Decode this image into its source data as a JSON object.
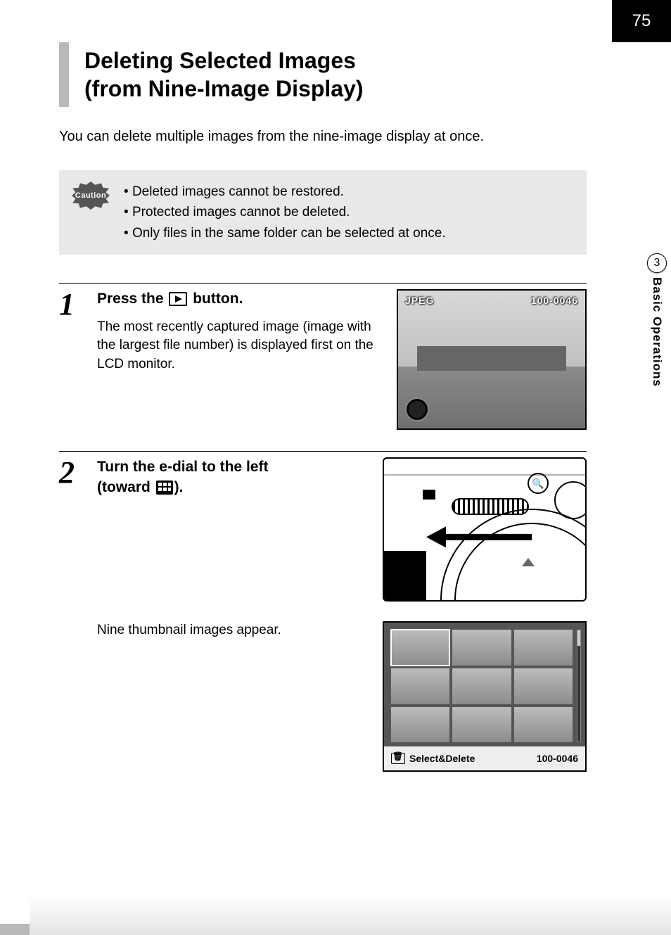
{
  "page_number": "75",
  "side_tab": {
    "chapter_number": "3",
    "chapter_label": "Basic Operations"
  },
  "title": {
    "line1": "Deleting Selected Images",
    "line2": "(from Nine-Image Display)"
  },
  "intro": "You can delete multiple images from the nine-image display at once.",
  "caution": {
    "label": "Caution",
    "items": [
      "Deleted images cannot be restored.",
      "Protected images cannot be deleted.",
      "Only files in the same folder can be selected at once."
    ]
  },
  "step1": {
    "number": "1",
    "heading_prefix": "Press the ",
    "heading_suffix": " button.",
    "desc": "The most recently captured image (image with the largest file number) is displayed first on the LCD monitor.",
    "lcd": {
      "format": "JPEG",
      "file_number": "100-0046"
    }
  },
  "step2": {
    "number": "2",
    "heading_line1_prefix": "Turn the e-dial to the left",
    "heading_line2_prefix": "(toward ",
    "heading_line2_suffix": ").",
    "dial": {
      "zoom_icon": "🔍"
    },
    "desc2": "Nine thumbnail images appear.",
    "thumb_footer": {
      "action": "Select&Delete",
      "file_number": "100-0046"
    }
  }
}
